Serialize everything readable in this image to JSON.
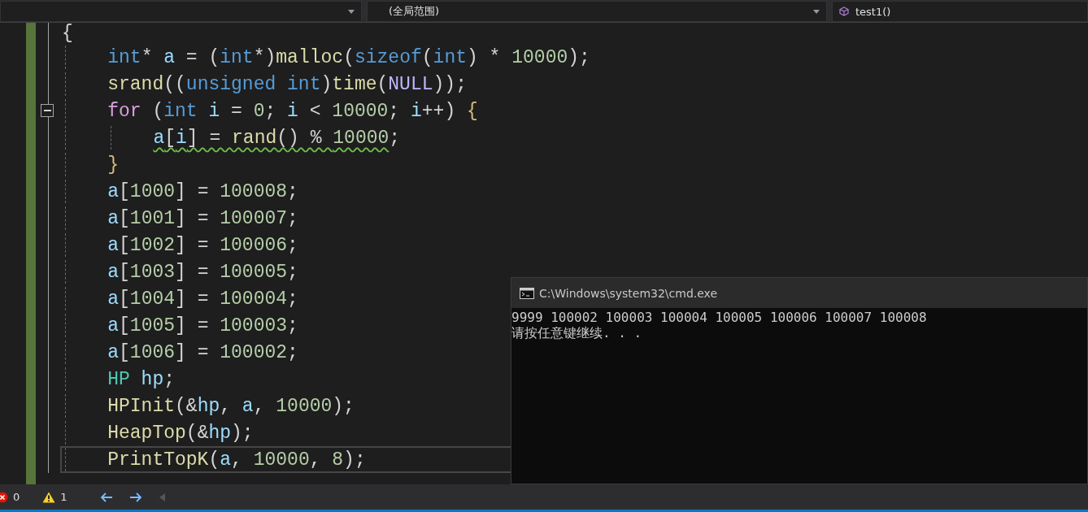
{
  "navigation_bar": {
    "dropdowns": [
      {
        "kind": "plain"
      },
      {
        "kind": "plain",
        "value": "(全局范围)"
      },
      {
        "kind": "function",
        "value": "test1()"
      }
    ]
  },
  "code_lines": [
    {
      "tokens": [
        {
          "t": "{",
          "kind": "punct"
        }
      ],
      "children": [
        {
          "tokens": [
            {
              "t": "int",
              "kind": "keyword"
            },
            {
              "t": "* ",
              "kind": "punct"
            },
            {
              "t": "a",
              "kind": "var"
            },
            {
              "t": " = (",
              "kind": "punct"
            },
            {
              "t": "int",
              "kind": "keyword"
            },
            {
              "t": "*)",
              "kind": "punct"
            },
            {
              "t": "malloc",
              "kind": "func"
            },
            {
              "t": "(",
              "kind": "punct"
            },
            {
              "t": "sizeof",
              "kind": "keyword"
            },
            {
              "t": "(",
              "kind": "punct"
            },
            {
              "t": "int",
              "kind": "keyword"
            },
            {
              "t": ") * ",
              "kind": "punct"
            },
            {
              "t": "10000",
              "kind": "number"
            },
            {
              "t": ");",
              "kind": "punct"
            }
          ]
        },
        {
          "tokens": [
            {
              "t": "srand",
              "kind": "func"
            },
            {
              "t": "((",
              "kind": "punct"
            },
            {
              "t": "unsigned int",
              "kind": "keyword"
            },
            {
              "t": ")",
              "kind": "punct"
            },
            {
              "t": "time",
              "kind": "func"
            },
            {
              "t": "(",
              "kind": "punct"
            },
            {
              "t": "NULL",
              "kind": "macro"
            },
            {
              "t": "));",
              "kind": "punct"
            }
          ]
        },
        {
          "expanded": true,
          "tokens": [
            {
              "t": "for",
              "kind": "control"
            },
            {
              "t": " (",
              "kind": "punct"
            },
            {
              "t": "int",
              "kind": "keyword"
            },
            {
              "t": " i",
              "kind": "var"
            },
            {
              "t": " = ",
              "kind": "punct"
            },
            {
              "t": "0",
              "kind": "number"
            },
            {
              "t": "; ",
              "kind": "punct"
            },
            {
              "t": "i",
              "kind": "var"
            },
            {
              "t": " < ",
              "kind": "punct"
            },
            {
              "t": "10000",
              "kind": "number"
            },
            {
              "t": "; ",
              "kind": "punct"
            },
            {
              "t": "i",
              "kind": "var"
            },
            {
              "t": "++) ",
              "kind": "punct"
            },
            {
              "t": "{",
              "kind": "brace"
            }
          ],
          "children": [
            {
              "tokens": [
                {
                  "t": "a",
                  "kind": "var",
                  "warning": true
                },
                {
                  "t": "[",
                  "kind": "punct",
                  "warning": true
                },
                {
                  "t": "i",
                  "kind": "var",
                  "warning": true
                },
                {
                  "t": "] = ",
                  "kind": "punct",
                  "warning": true
                },
                {
                  "t": "rand",
                  "kind": "func",
                  "warning": true
                },
                {
                  "t": "() % ",
                  "kind": "punct",
                  "warning": true
                },
                {
                  "t": "10000",
                  "kind": "number",
                  "warning": true
                },
                {
                  "t": ";",
                  "kind": "punct"
                }
              ]
            }
          ]
        },
        {
          "tokens": [
            {
              "t": "}",
              "kind": "brace"
            }
          ]
        },
        {
          "tokens": [
            {
              "t": "a",
              "kind": "var"
            },
            {
              "t": "[",
              "kind": "punct"
            },
            {
              "t": "1000",
              "kind": "number"
            },
            {
              "t": "] = ",
              "kind": "punct"
            },
            {
              "t": "100008",
              "kind": "number"
            },
            {
              "t": ";",
              "kind": "punct"
            }
          ]
        },
        {
          "tokens": [
            {
              "t": "a",
              "kind": "var"
            },
            {
              "t": "[",
              "kind": "punct"
            },
            {
              "t": "1001",
              "kind": "number"
            },
            {
              "t": "] = ",
              "kind": "punct"
            },
            {
              "t": "100007",
              "kind": "number"
            },
            {
              "t": ";",
              "kind": "punct"
            }
          ]
        },
        {
          "tokens": [
            {
              "t": "a",
              "kind": "var"
            },
            {
              "t": "[",
              "kind": "punct"
            },
            {
              "t": "1002",
              "kind": "number"
            },
            {
              "t": "] = ",
              "kind": "punct"
            },
            {
              "t": "100006",
              "kind": "number"
            },
            {
              "t": ";",
              "kind": "punct"
            }
          ]
        },
        {
          "tokens": [
            {
              "t": "a",
              "kind": "var"
            },
            {
              "t": "[",
              "kind": "punct"
            },
            {
              "t": "1003",
              "kind": "number"
            },
            {
              "t": "] = ",
              "kind": "punct"
            },
            {
              "t": "100005",
              "kind": "number"
            },
            {
              "t": ";",
              "kind": "punct"
            }
          ]
        },
        {
          "tokens": [
            {
              "t": "a",
              "kind": "var"
            },
            {
              "t": "[",
              "kind": "punct"
            },
            {
              "t": "1004",
              "kind": "number"
            },
            {
              "t": "] = ",
              "kind": "punct"
            },
            {
              "t": "100004",
              "kind": "number"
            },
            {
              "t": ";",
              "kind": "punct"
            }
          ]
        },
        {
          "tokens": [
            {
              "t": "a",
              "kind": "var"
            },
            {
              "t": "[",
              "kind": "punct"
            },
            {
              "t": "1005",
              "kind": "number"
            },
            {
              "t": "] = ",
              "kind": "punct"
            },
            {
              "t": "100003",
              "kind": "number"
            },
            {
              "t": ";",
              "kind": "punct"
            }
          ]
        },
        {
          "tokens": [
            {
              "t": "a",
              "kind": "var"
            },
            {
              "t": "[",
              "kind": "punct"
            },
            {
              "t": "1006",
              "kind": "number"
            },
            {
              "t": "] = ",
              "kind": "punct"
            },
            {
              "t": "100002",
              "kind": "number"
            },
            {
              "t": ";",
              "kind": "punct"
            }
          ]
        },
        {
          "tokens": [
            {
              "t": "HP",
              "kind": "type"
            },
            {
              "t": " hp",
              "kind": "var"
            },
            {
              "t": ";",
              "kind": "punct"
            }
          ]
        },
        {
          "tokens": [
            {
              "t": "HPInit",
              "kind": "func"
            },
            {
              "t": "(&",
              "kind": "punct"
            },
            {
              "t": "hp",
              "kind": "var"
            },
            {
              "t": ", ",
              "kind": "punct"
            },
            {
              "t": "a",
              "kind": "var"
            },
            {
              "t": ", ",
              "kind": "punct"
            },
            {
              "t": "10000",
              "kind": "number"
            },
            {
              "t": ");",
              "kind": "punct"
            }
          ]
        },
        {
          "tokens": [
            {
              "t": "HeapTop",
              "kind": "func"
            },
            {
              "t": "(&",
              "kind": "punct"
            },
            {
              "t": "hp",
              "kind": "var"
            },
            {
              "t": ");",
              "kind": "punct"
            }
          ]
        },
        {
          "current": true,
          "tokens": [
            {
              "t": "PrintTopK",
              "kind": "func"
            },
            {
              "t": "(",
              "kind": "punct"
            },
            {
              "t": "a",
              "kind": "var"
            },
            {
              "t": ", ",
              "kind": "punct"
            },
            {
              "t": "10000",
              "kind": "number"
            },
            {
              "t": ", ",
              "kind": "punct"
            },
            {
              "t": "8",
              "kind": "number"
            },
            {
              "t": ");",
              "kind": "punct"
            }
          ]
        }
      ]
    }
  ],
  "status_bar": {
    "errors": "0",
    "warnings": "1"
  },
  "console": {
    "title": "C:\\Windows\\system32\\cmd.exe",
    "lines": [
      "9999 100002 100003 100004 100005 100006 100007 100008",
      "请按任意键继续. . ."
    ]
  }
}
